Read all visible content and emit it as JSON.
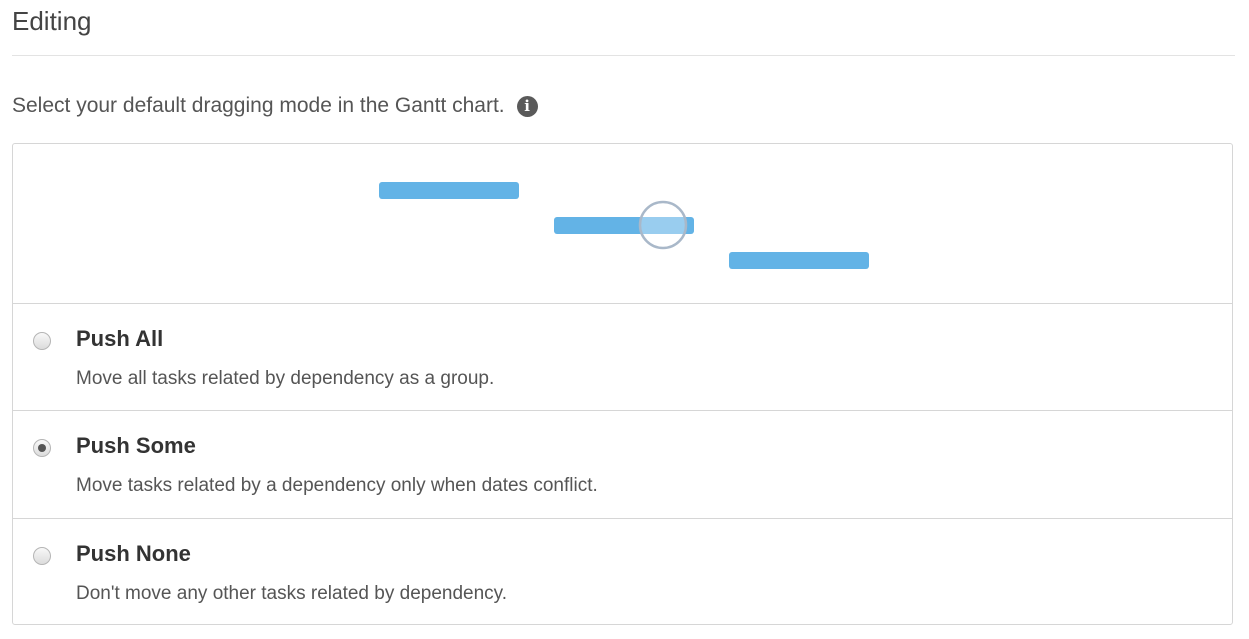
{
  "section": {
    "title": "Editing"
  },
  "instruction": {
    "text": "Select your default dragging mode in the Gantt chart.",
    "icon": "info-icon"
  },
  "preview": {
    "bar_color": "#63b3e6",
    "handle_icon": "drag-handle-circle"
  },
  "options": [
    {
      "label": "Push All",
      "description": "Move all tasks related by dependency as a group.",
      "selected": false
    },
    {
      "label": "Push Some",
      "description": "Move tasks related by a dependency only when dates conflict.",
      "selected": true
    },
    {
      "label": "Push None",
      "description": "Don't move any other tasks related by dependency.",
      "selected": false
    }
  ]
}
